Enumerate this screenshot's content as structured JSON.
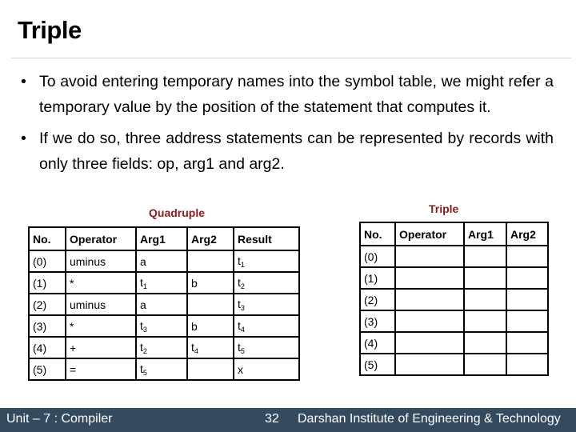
{
  "slide": {
    "title": "Triple",
    "bullets": [
      "To avoid entering temporary names into the symbol table, we might refer a temporary value by the position of the statement that computes it.",
      "If we do so, three address statements can be represented by records with only three fields: op, arg1 and arg2."
    ],
    "bullet_glyph": "•"
  },
  "quadruple": {
    "caption": "Quadruple",
    "headers": [
      "No.",
      "Operator",
      "Arg1",
      "Arg2",
      "Result"
    ],
    "rows": [
      [
        {
          "t": "(0)"
        },
        {
          "t": "uminus"
        },
        {
          "t": "a"
        },
        {
          "t": ""
        },
        {
          "t": "t",
          "s": "1"
        }
      ],
      [
        {
          "t": "(1)"
        },
        {
          "t": "*"
        },
        {
          "t": "t",
          "s": "1"
        },
        {
          "t": "b"
        },
        {
          "t": "t",
          "s": "2"
        }
      ],
      [
        {
          "t": "(2)"
        },
        {
          "t": "uminus"
        },
        {
          "t": "a"
        },
        {
          "t": ""
        },
        {
          "t": "t",
          "s": "3"
        }
      ],
      [
        {
          "t": "(3)"
        },
        {
          "t": "*"
        },
        {
          "t": "t",
          "s": "3"
        },
        {
          "t": "b"
        },
        {
          "t": "t",
          "s": "4"
        }
      ],
      [
        {
          "t": "(4)"
        },
        {
          "t": "+"
        },
        {
          "t": "t",
          "s": "2"
        },
        {
          "t": "t",
          "s": "4"
        },
        {
          "t": "t",
          "s": "5"
        }
      ],
      [
        {
          "t": "(5)"
        },
        {
          "t": "="
        },
        {
          "t": "t",
          "s": "5"
        },
        {
          "t": ""
        },
        {
          "t": "x"
        }
      ]
    ]
  },
  "triple": {
    "caption": "Triple",
    "headers": [
      "No.",
      "Operator",
      "Arg1",
      "Arg2"
    ],
    "rows": [
      [
        {
          "t": "(0)"
        },
        {
          "t": ""
        },
        {
          "t": ""
        },
        {
          "t": ""
        }
      ],
      [
        {
          "t": "(1)"
        },
        {
          "t": ""
        },
        {
          "t": ""
        },
        {
          "t": ""
        }
      ],
      [
        {
          "t": "(2)"
        },
        {
          "t": ""
        },
        {
          "t": ""
        },
        {
          "t": ""
        }
      ],
      [
        {
          "t": "(3)"
        },
        {
          "t": ""
        },
        {
          "t": ""
        },
        {
          "t": ""
        }
      ],
      [
        {
          "t": "(4)"
        },
        {
          "t": ""
        },
        {
          "t": ""
        },
        {
          "t": ""
        }
      ],
      [
        {
          "t": "(5)"
        },
        {
          "t": ""
        },
        {
          "t": ""
        },
        {
          "t": ""
        }
      ]
    ]
  },
  "footer": {
    "unit": "Unit – 7 : Compiler",
    "page_number": "32",
    "institute": "Darshan Institute of Engineering & Technology"
  },
  "colors": {
    "caption": "#8b1a1a",
    "footer_bg": "#344a5f"
  }
}
